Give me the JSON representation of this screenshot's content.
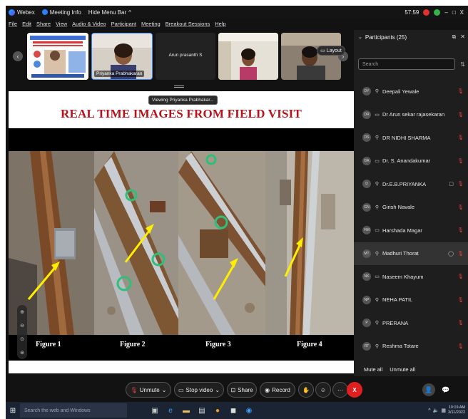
{
  "titlebar": {
    "app": "Webex",
    "meeting_info": "Meeting Info",
    "hide_menu": "Hide Menu Bar",
    "hide_menu_caret": "^",
    "time": "57:59",
    "minimize": "–",
    "maximize": "□",
    "close": "X"
  },
  "menu": [
    "File",
    "Edit",
    "Share",
    "View",
    "Audio & Video",
    "Participant",
    "Meeting",
    "Breakout Sessions",
    "Help"
  ],
  "video_strip": {
    "tiles": [
      {
        "name": ""
      },
      {
        "name": "Priyanka Prabhakaran"
      },
      {
        "name": "Arun prasanth S"
      },
      {
        "name": ""
      },
      {
        "name": ""
      }
    ],
    "layout_label": "Layout",
    "viewing_text": "Viewing Priyanka Prabhakar..."
  },
  "slide": {
    "title": "REAL TIME IMAGES FROM FIELD VISIT",
    "figures": [
      "Figure 1",
      "Figure 2",
      "Figure 3",
      "Figure 4"
    ]
  },
  "participants": {
    "header": "Participants (25)",
    "search_placeholder": "Search",
    "list": [
      {
        "initials": "DY",
        "name": "Deepali Yewale",
        "device": "phone",
        "video": false,
        "highlight": false
      },
      {
        "initials": "DR",
        "name": "Dr Arun sekar rajasekaran",
        "device": "desktop",
        "video": false,
        "highlight": false
      },
      {
        "initials": "DS",
        "name": "DR NIDHI SHARMA",
        "device": "phone",
        "video": false,
        "highlight": false
      },
      {
        "initials": "DA",
        "name": "Dr. S. Anandakumar",
        "device": "desktop",
        "video": false,
        "highlight": false
      },
      {
        "initials": "D",
        "name": "Dr.E.B.PRIYANKA",
        "device": "phone",
        "video": true,
        "highlight": false
      },
      {
        "initials": "GN",
        "name": "Girish Navale",
        "device": "phone",
        "video": false,
        "highlight": false
      },
      {
        "initials": "HM",
        "name": "Harshada Magar",
        "device": "desktop",
        "video": false,
        "highlight": false
      },
      {
        "initials": "MT",
        "name": "Madhuri Thorat",
        "device": "phone",
        "video": true,
        "highlight": true
      },
      {
        "initials": "NK",
        "name": "Naseem Khayum",
        "device": "desktop",
        "video": false,
        "highlight": false
      },
      {
        "initials": "NP",
        "name": "NEHA PATIL",
        "device": "phone",
        "video": false,
        "highlight": false
      },
      {
        "initials": "P",
        "name": "PRERANA",
        "device": "phone",
        "video": false,
        "highlight": false
      },
      {
        "initials": "RT",
        "name": "Reshma Totare",
        "device": "phone",
        "video": false,
        "highlight": false
      }
    ],
    "mute_all": "Mute all",
    "unmute_all": "Unmute all"
  },
  "controls": {
    "unmute": "Unmute",
    "stop_video": "Stop video",
    "share": "Share",
    "record": "Record",
    "end_glyph": "X"
  },
  "taskbar": {
    "search_placeholder": "Search the web and Windows",
    "time": "10:19 AM",
    "date": "3/11/2022"
  },
  "colors": {
    "accent_red": "#e02020",
    "slide_title": "#b5121b",
    "panel_bg": "#1e1e1e"
  }
}
